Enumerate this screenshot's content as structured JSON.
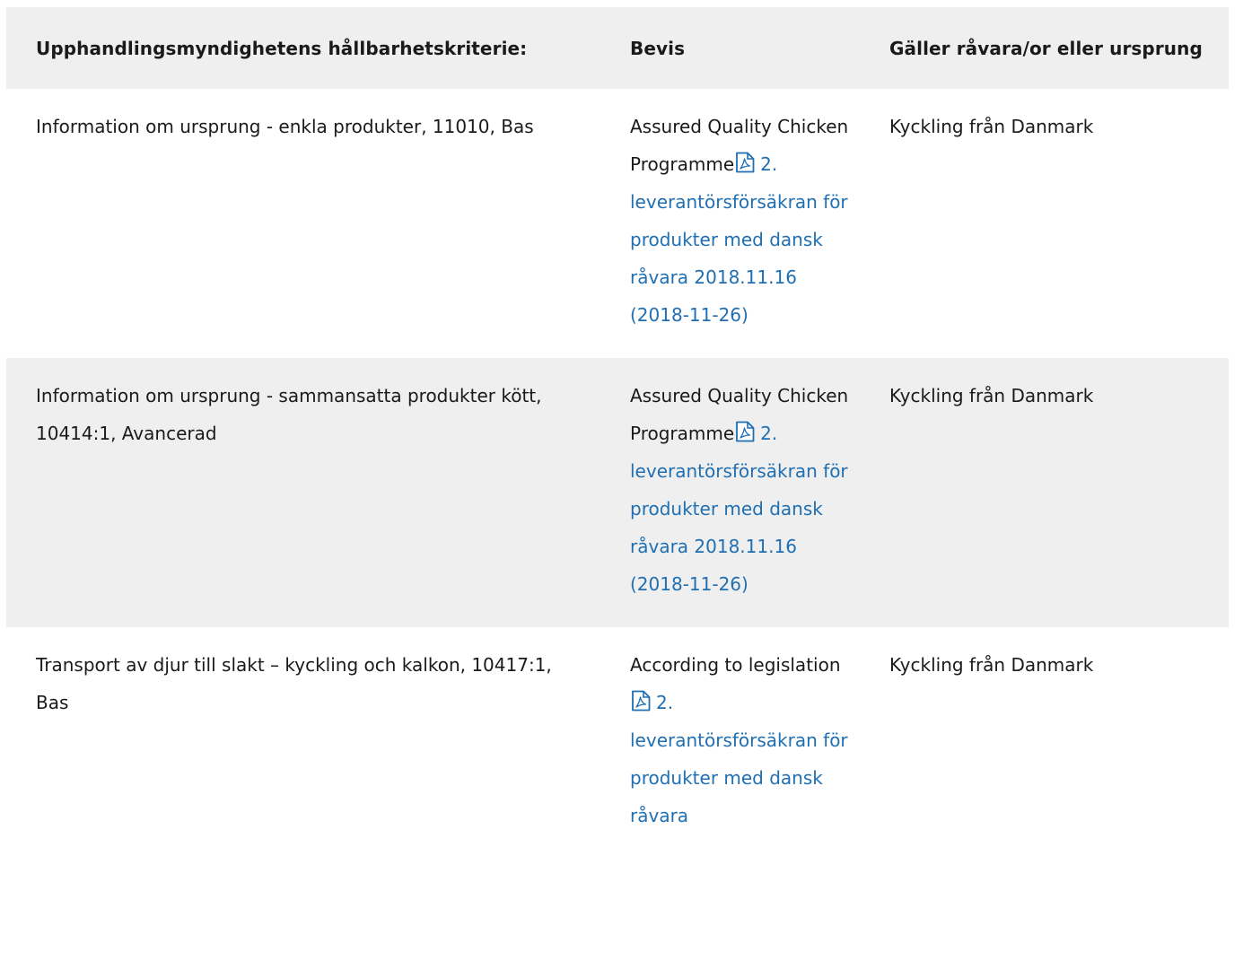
{
  "table": {
    "headers": {
      "criteria": "Upphandlingsmyndighetens hållbarhetskriterie:",
      "evidence": "Bevis",
      "applies_to": "Gäller råvara/or eller ursprung"
    },
    "rows": [
      {
        "criteria": "Information om ursprung - enkla produkter, 11010, Bas",
        "evidence_text": "Assured Quality Chicken Programme",
        "evidence_icon": "pdf-icon",
        "evidence_link": "2. leverantörsförsäkran för produkter med dansk råvara 2018.11.16 (2018-11-26)",
        "applies_to": "Kyckling från Danmark"
      },
      {
        "criteria": "Information om ursprung - sammansatta produkter kött, 10414:1, Avancerad",
        "evidence_text": "Assured Quality Chicken Programme",
        "evidence_icon": "pdf-icon",
        "evidence_link": "2. leverantörsförsäkran för produkter med dansk råvara 2018.11.16 (2018-11-26)",
        "applies_to": "Kyckling från Danmark"
      },
      {
        "criteria": "Transport av djur till slakt – kyckling och kalkon, 10417:1, Bas",
        "evidence_text": "According to legislation",
        "evidence_icon": "pdf-icon",
        "evidence_link": "2. leverantörsförsäkran för produkter med dansk råvara",
        "applies_to": "Kyckling från Danmark"
      }
    ]
  },
  "colors": {
    "header_bg": "#efefef",
    "stripe_bg": "#efefef",
    "link": "#1f6fb2",
    "text": "#1a1a1a"
  }
}
